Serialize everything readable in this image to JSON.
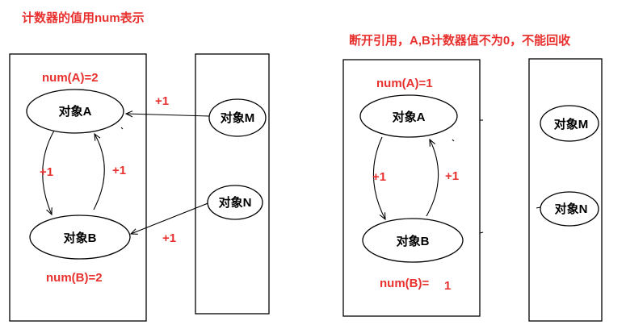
{
  "left_panel": {
    "heading": "计数器的值用num表示",
    "count_a": "num(A)=2",
    "count_b": "num(B)=2",
    "object_a": "对象A",
    "object_b": "对象B",
    "object_m": "对象M",
    "object_n": "对象N",
    "ref_m_to_a": "+1",
    "ref_a_to_b": "+1",
    "ref_b_to_a": "+1",
    "ref_n_to_b": "+1"
  },
  "right_panel": {
    "heading": "断开引用，A,B计数器值不为0，不能回收",
    "count_a": "num(A)=1",
    "count_b_label": "num(B)=",
    "count_b_value": "1",
    "object_a": "对象A",
    "object_b": "对象B",
    "object_m": "对象M",
    "object_n": "对象N",
    "ref_a_to_b": "+1",
    "ref_b_to_a": "+1"
  },
  "colors": {
    "annotation": "#e8312f",
    "stroke": "#000000",
    "background": "#ffffff"
  }
}
